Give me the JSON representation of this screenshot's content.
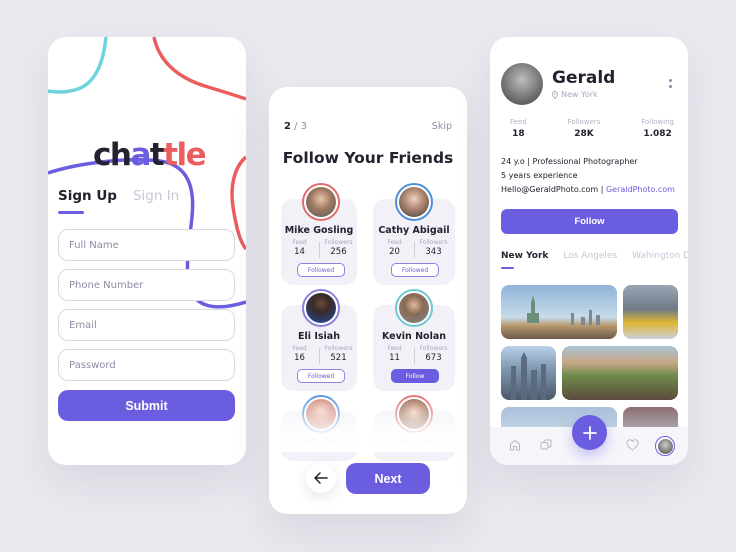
{
  "signup": {
    "logo": {
      "c": "ch",
      "a": "a",
      "t": "t",
      "le": "tle"
    },
    "tabs": [
      {
        "label": "Sign Up",
        "active": true
      },
      {
        "label": "Sign In",
        "active": false
      }
    ],
    "fields": [
      {
        "placeholder": "Full Name",
        "value": ""
      },
      {
        "placeholder": "Phone Number",
        "value": ""
      },
      {
        "placeholder": "Email",
        "value": ""
      },
      {
        "placeholder": "Password",
        "value": ""
      }
    ],
    "submit_label": "Submit"
  },
  "follow": {
    "step_current": "2",
    "step_sep": " / ",
    "step_total": "3",
    "skip_label": "Skip",
    "title": "Follow Your Friends",
    "feed_label": "Feed",
    "followers_label": "Followers",
    "people": [
      {
        "name": "Mike Gosling",
        "feed": "14",
        "followers": "256",
        "button": "Followed",
        "followed": true,
        "ring": "#e06b6b"
      },
      {
        "name": "Cathy Abigail",
        "feed": "20",
        "followers": "343",
        "button": "Followed",
        "followed": true,
        "ring": "#4f8fd9"
      },
      {
        "name": "Eli Isiah",
        "feed": "16",
        "followers": "521",
        "button": "Followed",
        "followed": true,
        "ring": "#8d7fe0"
      },
      {
        "name": "Kevin Nolan",
        "feed": "11",
        "followers": "673",
        "button": "Follow",
        "followed": false,
        "ring": "#6fc9d4"
      },
      {
        "name": "Carla Berg",
        "ring": "#4f8fd9"
      },
      {
        "name": "Lydia Sein",
        "ring": "#e06b6b"
      }
    ],
    "next_label": "Next",
    "back_icon": "arrow-left-icon"
  },
  "profile": {
    "name": "Gerald",
    "location": "New York",
    "stats": [
      {
        "label": "Feed",
        "value": "18"
      },
      {
        "label": "Followers",
        "value": "28K"
      },
      {
        "label": "Following",
        "value": "1.082"
      }
    ],
    "bio_line1": "24 y.o | Professional Photographer",
    "bio_line2": "5 years experience",
    "bio_email": "Hello@GeraldPhoto.com",
    "bio_sep": " | ",
    "bio_link": "GeraldPhoto.com",
    "follow_label": "Follow",
    "tabs": [
      {
        "label": "New York",
        "active": true
      },
      {
        "label": "Los Angeles",
        "active": false
      },
      {
        "label": "Wahington DC",
        "active": false
      }
    ],
    "nav": [
      "home-icon",
      "chat-icon",
      "add-icon",
      "heart-icon",
      "profile-avatar"
    ]
  },
  "colors": {
    "accent": "#6b5de0",
    "coral": "#ec5e5e",
    "cyan": "#6dd3de",
    "text": "#23222f",
    "muted": "#8d8ca6",
    "background": "#e9e9ef"
  }
}
